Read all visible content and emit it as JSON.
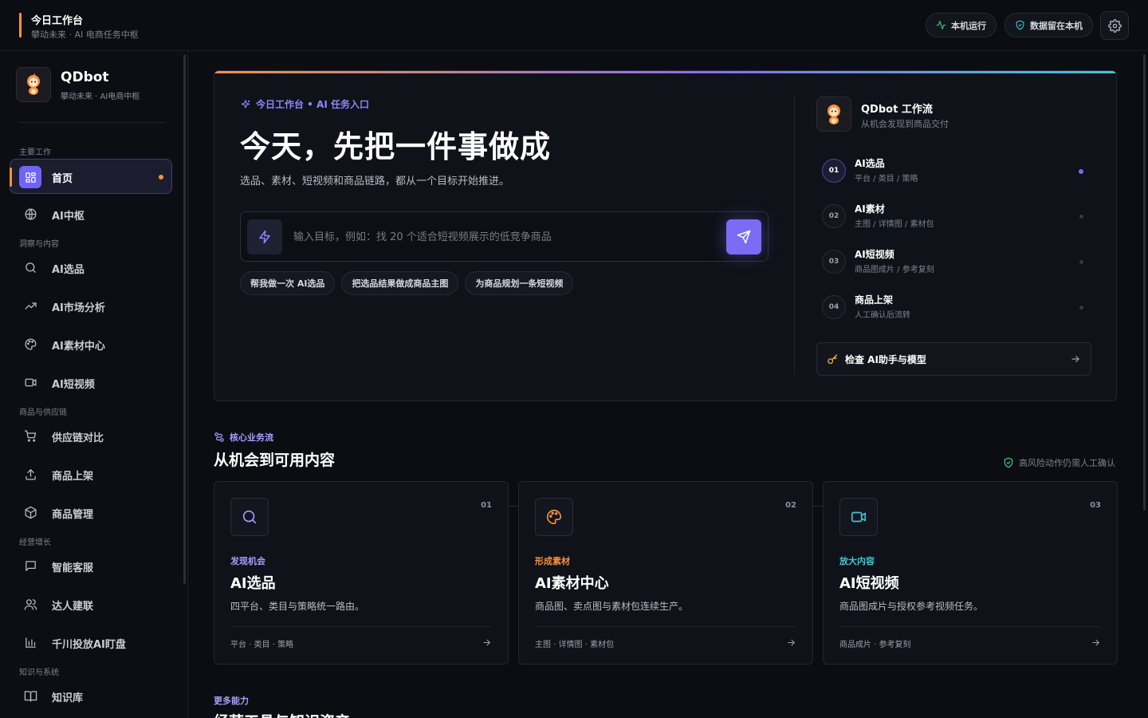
{
  "topbar": {
    "title": "今日工作台",
    "subtitle": "攀动未来 · AI 电商任务中枢",
    "status_run": "本机运行",
    "status_data": "数据留在本机"
  },
  "sidebar": {
    "brand_name": "QDbot",
    "brand_sub": "攀动未来 · AI电商中枢",
    "sections": [
      "主要工作",
      "洞察与内容",
      "商品与供应链",
      "经营增长",
      "知识与系统"
    ],
    "items": [
      {
        "label": "首页",
        "icon": "grid-icon",
        "active": true
      },
      {
        "label": "AI中枢",
        "icon": "globe-icon"
      },
      {
        "label": "AI选品",
        "icon": "search-icon"
      },
      {
        "label": "AI市场分析",
        "icon": "trending-up-icon"
      },
      {
        "label": "AI素材中心",
        "icon": "palette-icon"
      },
      {
        "label": "AI短视频",
        "icon": "video-icon"
      },
      {
        "label": "供应链对比",
        "icon": "cart-icon"
      },
      {
        "label": "商品上架",
        "icon": "upload-icon"
      },
      {
        "label": "商品管理",
        "icon": "box-icon"
      },
      {
        "label": "智能客服",
        "icon": "chat-icon"
      },
      {
        "label": "达人建联",
        "icon": "users-icon"
      },
      {
        "label": "千川投放AI盯盘",
        "icon": "bar-chart-icon"
      },
      {
        "label": "知识库",
        "icon": "book-icon"
      }
    ]
  },
  "hero": {
    "tagline": "今日工作台 • AI 任务入口",
    "headline": "今天，先把一件事做成",
    "description": "选品、素材、短视频和商品链路，都从一个目标开始推进。",
    "input_placeholder": "输入目标，例如：找 20 个适合短视频展示的低竞争商品",
    "chips": [
      "帮我做一次 AI选品",
      "把选品结果做成商品主图",
      "为商品规划一条短视频"
    ]
  },
  "workflow": {
    "title": "QDbot 工作流",
    "subtitle": "从机会发现到商品交付",
    "steps": [
      {
        "num": "01",
        "name": "AI选品",
        "sub": "平台 / 类目 / 策略"
      },
      {
        "num": "02",
        "name": "AI素材",
        "sub": "主图 / 详情图 / 素材包"
      },
      {
        "num": "03",
        "name": "AI短视频",
        "sub": "商品图成片 / 参考复刻"
      },
      {
        "num": "04",
        "name": "商品上架",
        "sub": "人工确认后流转"
      }
    ],
    "check_button": "检查 AI助手与模型"
  },
  "core": {
    "tag": "核心业务流",
    "title": "从机会到可用内容",
    "note": "高风险动作仍需人工确认",
    "cards": [
      {
        "num": "01",
        "tag": "发现机会",
        "title": "AI选品",
        "desc": "四平台、类目与策略统一路由。",
        "meta": "平台 · 类目 · 策略",
        "color": "#a89cff",
        "icon": "search-icon"
      },
      {
        "num": "02",
        "tag": "形成素材",
        "title": "AI素材中心",
        "desc": "商品图、卖点图与素材包连续生产。",
        "meta": "主图 · 详情图 · 素材包",
        "color": "#f5923e",
        "icon": "palette-icon"
      },
      {
        "num": "03",
        "tag": "放大内容",
        "title": "AI短视频",
        "desc": "商品图成片与授权参考视频任务。",
        "meta": "商品成片 · 参考复刻",
        "color": "#3fc6d6",
        "icon": "video-icon"
      }
    ]
  },
  "more": {
    "tag": "更多能力",
    "title": "经营工具与知识资产"
  },
  "colors": {
    "accent_orange": "#f5923e",
    "accent_purple": "#7b6cf6",
    "accent_cyan": "#3fc6d6",
    "background": "#0b0d12"
  }
}
